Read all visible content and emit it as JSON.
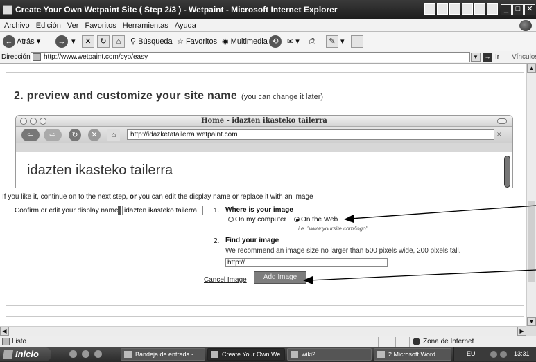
{
  "window": {
    "title": "Create Your Own Wetpaint Site ( Step 2/3 ) - Wetpaint - Microsoft Internet Explorer"
  },
  "menu": [
    "Archivo",
    "Edición",
    "Ver",
    "Favoritos",
    "Herramientas",
    "Ayuda"
  ],
  "toolbar": {
    "back": "Atrás",
    "search": "Búsqueda",
    "favorites": "Favoritos",
    "multimedia": "Multimedia"
  },
  "address": {
    "label": "Dirección",
    "url": "http://www.wetpaint.com/cyo/easy",
    "go": "Ir",
    "links": "Vínculos"
  },
  "page": {
    "step_heading": "2. preview and customize your site name",
    "step_note": "(you can change it later)",
    "preview": {
      "window_title": "Home - idazten ikasteko tailerra",
      "url": "http://idazketatailerra.wetpaint.com",
      "site_name": "idazten ikasteko tailerra"
    },
    "intro_before": "If you like it, continue on to the next step,",
    "intro_or": "or",
    "intro_after": "you can edit the display name or replace it with an image",
    "confirm_label": "Confirm or edit your display name",
    "display_name": "idazten ikasteko tailerra",
    "where": {
      "number": "1.",
      "title": "Where is your image",
      "option_computer": "On my computer",
      "option_web": "On the Web",
      "selected": "On the Web",
      "hint": "i.e. \"www.yoursite.com/logo\""
    },
    "find": {
      "number": "2.",
      "title": "Find your image",
      "recommendation": "We recommend an image size no larger than 500 pixels wide, 200 pixels tall.",
      "url_value": "http://"
    },
    "cancel_label": "Cancel Image",
    "add_label": "Add Image"
  },
  "status": {
    "text": "Listo",
    "zone": "Zona de Internet"
  },
  "taskbar": {
    "start": "Inicio",
    "tasks": [
      "Bandeja de entrada -...",
      "Create Your Own We...",
      "wiki2",
      "2 Microsoft Word"
    ],
    "lang": "EU",
    "clock": "13:31"
  }
}
